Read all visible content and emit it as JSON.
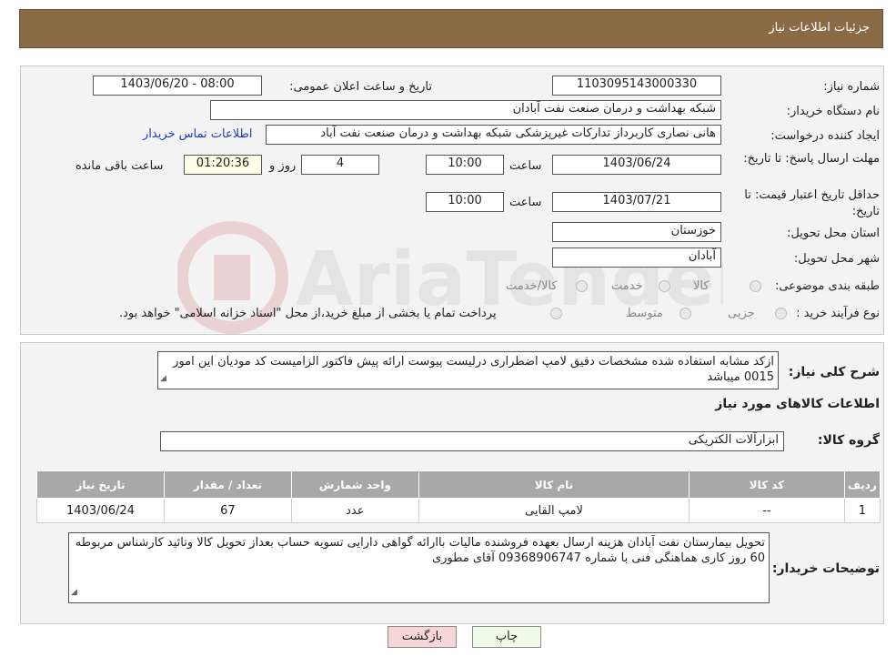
{
  "header": {
    "title": "جزئیات اطلاعات نیاز"
  },
  "form": {
    "need_number_label": "شماره نیاز:",
    "need_number": "1103095143000330",
    "announce_label": "تاریخ و ساعت اعلان عمومی:",
    "announce_value": "1403/06/20 - 08:00",
    "buyer_org_label": "نام دستگاه خریدار:",
    "buyer_org": "شبکه بهداشت و درمان صنعت نفت آبادان",
    "creator_label": "ایجاد کننده درخواست:",
    "creator": "هانی نصاری کاربرداز تدارکات غیرپزشکی شبکه بهداشت و درمان صنعت نفت آباد",
    "contact_link": "اطلاعات تماس خریدار",
    "deadline_label": "مهلت ارسال پاسخ: تا تاریخ:",
    "deadline_date": "1403/06/24",
    "hour_label": "ساعت",
    "deadline_time": "10:00",
    "days_value": "4",
    "days_label": "روز و",
    "remaining_time": "01:20:36",
    "remaining_label": "ساعت باقی مانده",
    "price_validity_label": "حداقل تاریخ اعتبار قیمت: تا تاریخ:",
    "price_validity_date": "1403/07/21",
    "price_validity_time": "10:00",
    "province_label": "استان محل تحویل:",
    "province": "خوزستان",
    "city_label": "شهر محل تحویل:",
    "city": "آبادان",
    "category_label": "طبقه بندی موضوعی:",
    "category_options": [
      "کالا",
      "خدمت",
      "کالا/خدمت"
    ],
    "process_label": "نوع فرآیند خرید :",
    "process_options": [
      "جزیی",
      "متوسط"
    ],
    "process_note": "پرداخت تمام یا بخشی از مبلغ خرید،از محل \"اسناد خزانه اسلامی\" خواهد بود."
  },
  "details": {
    "summary_label": "شرح کلی نیاز:",
    "summary": "ازکد مشابه استفاده شده مشخصات دقیق لامپ اضطراری درلیست پیوست ارائه پیش فاکتور الزامیست کد مودیان این امور 0015 میباشد",
    "goods_info_title": "اطلاعات کالاهای مورد نیاز",
    "goods_group_label": "گروه کالا:",
    "goods_group": "ابزارآلات الکتریکی",
    "table": {
      "headers": [
        "ردیف",
        "کد کالا",
        "نام کالا",
        "واحد شمارش",
        "تعداد / مقدار",
        "تاریخ نیاز"
      ],
      "rows": [
        [
          "1",
          "--",
          "لامپ القایی",
          "عدد",
          "67",
          "1403/06/24"
        ]
      ]
    },
    "buyer_notes_label": "توضیحات خریدار:",
    "buyer_notes": "تحویل بیمارستان نفت آبادان هزینه ارسال بعهده فروشنده مالیات باارائه گواهی دارایی تسویه حساب بعداز تحویل کالا وتائید کارشناس مربوطه 60 روز کاری هماهنگی فنی با شماره 09368906747 آقای مطوری"
  },
  "buttons": {
    "print": "چاپ",
    "back": "بازگشت"
  },
  "colors": {
    "header": "#8b6b45",
    "back_button": "#f9d6d6",
    "link": "#1d39c4"
  }
}
